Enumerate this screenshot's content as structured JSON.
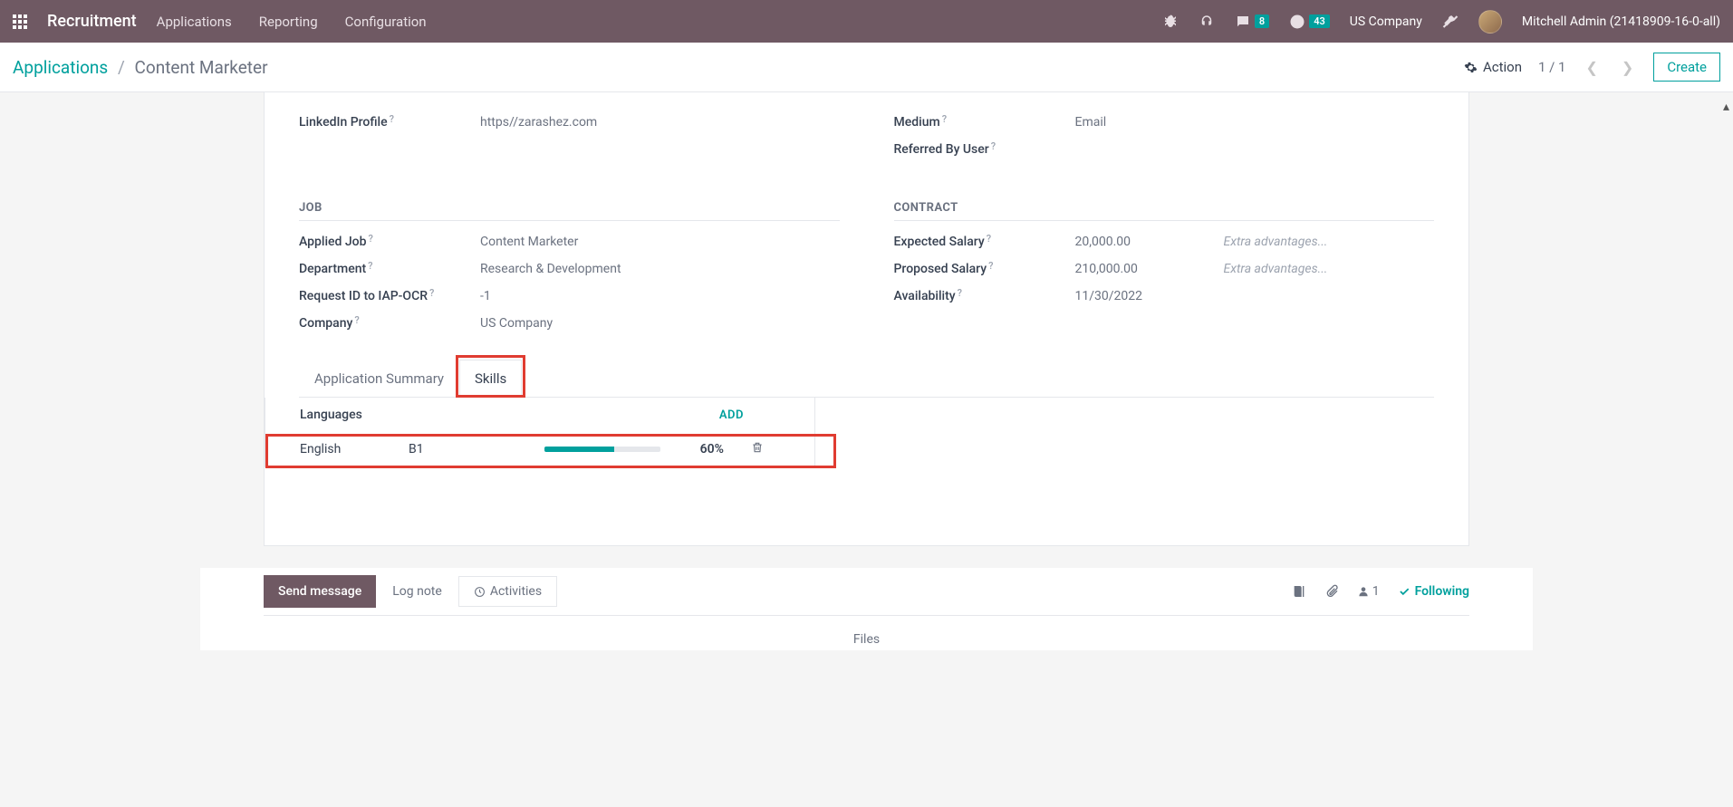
{
  "topbar": {
    "brand": "Recruitment",
    "nav": [
      "Applications",
      "Reporting",
      "Configuration"
    ],
    "chat_badge": "8",
    "clock_badge": "43",
    "company": "US Company",
    "user": "Mitchell Admin (21418909-16-0-all)"
  },
  "breadcrumb": {
    "root": "Applications",
    "current": "Content Marketer",
    "action_label": "Action",
    "pager": "1 / 1",
    "create": "Create"
  },
  "form": {
    "left_top": {
      "linkedin_label": "LinkedIn Profile",
      "linkedin": "https//zarashez.com"
    },
    "right_top": {
      "medium_label": "Medium",
      "medium": "Email",
      "referred_label": "Referred By User",
      "referred": ""
    },
    "job_section": "JOB",
    "job": {
      "applied_label": "Applied Job",
      "applied": "Content Marketer",
      "dept_label": "Department",
      "dept": "Research & Development",
      "req_label": "Request ID to IAP-OCR",
      "req": "-1",
      "company_label": "Company",
      "company": "US Company"
    },
    "contract_section": "CONTRACT",
    "contract": {
      "expected_label": "Expected Salary",
      "expected": "20,000.00",
      "proposed_label": "Proposed Salary",
      "proposed": "210,000.00",
      "extra_ph": "Extra advantages...",
      "avail_label": "Availability",
      "avail": "11/30/2022"
    }
  },
  "tabs": {
    "summary": "Application Summary",
    "skills": "Skills"
  },
  "skills_panel": {
    "header": "Languages",
    "add": "ADD",
    "row": {
      "name": "English",
      "level": "B1",
      "pct": "60%",
      "pct_val": 60
    }
  },
  "chatter": {
    "send": "Send message",
    "log": "Log note",
    "activities": "Activities",
    "follower_count": "1",
    "following": "Following",
    "files": "Files"
  }
}
